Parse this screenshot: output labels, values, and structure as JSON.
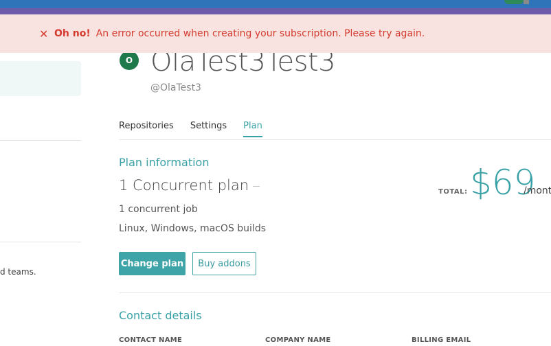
{
  "error": {
    "icon": "close-icon",
    "strong": "Oh no!",
    "message": "An error occurred when creating your subscription. Please try again."
  },
  "left_panel": {
    "teams_text": "d teams."
  },
  "org": {
    "avatar_initial": "O",
    "name": "OlaTest3Test3",
    "handle": "@OlaTest3"
  },
  "tabs": [
    {
      "label": "Repositories",
      "active": false
    },
    {
      "label": "Settings",
      "active": false
    },
    {
      "label": "Plan",
      "active": true
    }
  ],
  "plan": {
    "heading": "Plan information",
    "name": "1 Concurrent plan",
    "jobs": "1 concurrent job",
    "builds": "Linux, Windows, macOS builds",
    "total_label": "TOTAL:",
    "price": "$69",
    "period": "/mont",
    "change_button": "Change plan",
    "addons_button": "Buy addons"
  },
  "contact": {
    "heading": "Contact details",
    "columns": [
      "CONTACT NAME",
      "COMPANY NAME",
      "BILLING EMAIL"
    ]
  },
  "colors": {
    "accent": "#39a1a5",
    "error": "#d43b2f",
    "error_bg": "#f8e3e0",
    "topbar": "#2f73b8"
  }
}
